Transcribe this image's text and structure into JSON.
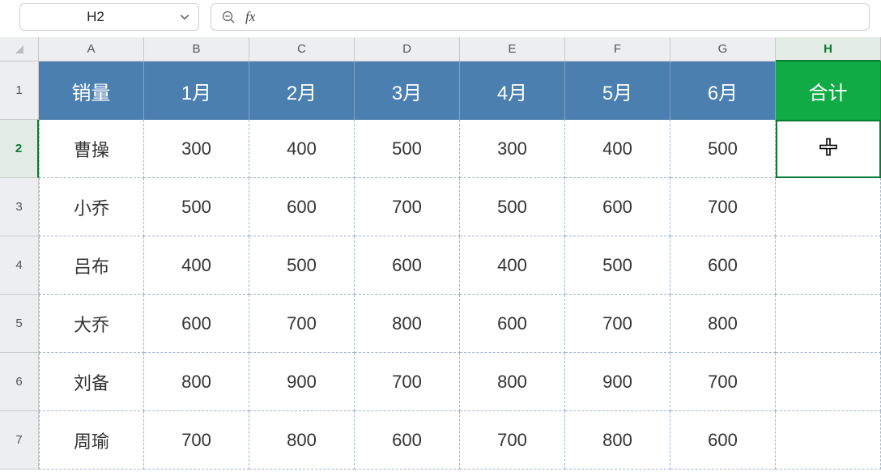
{
  "toolbar": {
    "namebox": "H2",
    "fx_label": "fx",
    "formula": ""
  },
  "columns": [
    "A",
    "B",
    "C",
    "D",
    "E",
    "F",
    "G",
    "H"
  ],
  "rows": [
    "1",
    "2",
    "3",
    "4",
    "5",
    "6",
    "7"
  ],
  "active_col": "H",
  "active_row": "2",
  "header_row": {
    "A": "销量",
    "B": "1月",
    "C": "2月",
    "D": "3月",
    "E": "4月",
    "F": "5月",
    "G": "6月",
    "H": "合计"
  },
  "data_rows": [
    {
      "A": "曹操",
      "B": "300",
      "C": "400",
      "D": "500",
      "E": "300",
      "F": "400",
      "G": "500",
      "H": ""
    },
    {
      "A": "小乔",
      "B": "500",
      "C": "600",
      "D": "700",
      "E": "500",
      "F": "600",
      "G": "700",
      "H": ""
    },
    {
      "A": "吕布",
      "B": "400",
      "C": "500",
      "D": "600",
      "E": "400",
      "F": "500",
      "G": "600",
      "H": ""
    },
    {
      "A": "大乔",
      "B": "600",
      "C": "700",
      "D": "800",
      "E": "600",
      "F": "700",
      "G": "800",
      "H": ""
    },
    {
      "A": "刘备",
      "B": "800",
      "C": "900",
      "D": "700",
      "E": "800",
      "F": "900",
      "G": "700",
      "H": ""
    },
    {
      "A": "周瑜",
      "B": "700",
      "C": "800",
      "D": "600",
      "E": "700",
      "F": "800",
      "G": "600",
      "H": ""
    }
  ],
  "chart_data": {
    "type": "table",
    "title": "销量",
    "categories": [
      "1月",
      "2月",
      "3月",
      "4月",
      "5月",
      "6月"
    ],
    "series": [
      {
        "name": "曹操",
        "values": [
          300,
          400,
          500,
          300,
          400,
          500
        ]
      },
      {
        "name": "小乔",
        "values": [
          500,
          600,
          700,
          500,
          600,
          700
        ]
      },
      {
        "name": "吕布",
        "values": [
          400,
          500,
          600,
          400,
          500,
          600
        ]
      },
      {
        "name": "大乔",
        "values": [
          600,
          700,
          800,
          600,
          700,
          800
        ]
      },
      {
        "name": "刘备",
        "values": [
          800,
          900,
          700,
          800,
          900,
          700
        ]
      },
      {
        "name": "周瑜",
        "values": [
          700,
          800,
          600,
          700,
          800,
          600
        ]
      }
    ],
    "total_column_label": "合计"
  }
}
